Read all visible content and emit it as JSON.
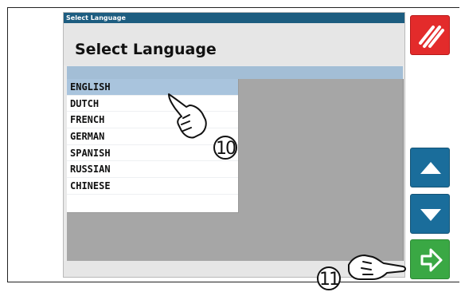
{
  "window": {
    "title_bar": "Select Language",
    "header_title": "Select Language"
  },
  "languages": [
    {
      "label": "ENGLISH",
      "selected": true
    },
    {
      "label": "DUTCH",
      "selected": false
    },
    {
      "label": "FRENCH",
      "selected": false
    },
    {
      "label": "GERMAN",
      "selected": false
    },
    {
      "label": "SPANISH",
      "selected": false
    },
    {
      "label": "RUSSIAN",
      "selected": false
    },
    {
      "label": "CHINESE",
      "selected": false
    }
  ],
  "side_buttons": {
    "cancel_icon": "diagonal-stripes-icon",
    "up_icon": "arrow-up-icon",
    "down_icon": "arrow-down-icon",
    "confirm_icon": "enter-arrow-icon"
  },
  "callouts": {
    "step_a": "10",
    "step_b": "11"
  },
  "colors": {
    "titlebar": "#1d5d80",
    "selected_row": "#a9c4dd",
    "cancel": "#e32b2b",
    "nav": "#1a6d9b",
    "confirm": "#3aa844"
  }
}
